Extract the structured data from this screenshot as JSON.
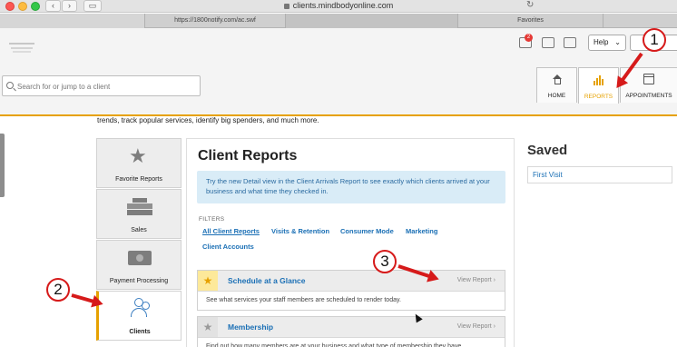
{
  "browser": {
    "url": "clients.mindbodyonline.com",
    "tabs": [
      "https://1800notify.com/ac.swf",
      "",
      "Favorites"
    ]
  },
  "header": {
    "notification_count": "2",
    "help_label": "Help",
    "search_placeholder": "Search for or jump to a client",
    "main_tabs": [
      {
        "label": "HOME",
        "icon": "home-icon"
      },
      {
        "label": "REPORTS",
        "icon": "bar-chart-icon"
      },
      {
        "label": "APPOINTMENTS",
        "icon": "calendar-icon"
      }
    ],
    "accent_color": "#e6a100"
  },
  "intro_text": "trends, track popular services, identify big spenders, and much more.",
  "sidebar": {
    "items": [
      {
        "label": "Favorite Reports",
        "icon": "star-icon"
      },
      {
        "label": "Sales",
        "icon": "cash-register-icon"
      },
      {
        "label": "Payment Processing",
        "icon": "credit-card-icon"
      },
      {
        "label": "Clients",
        "icon": "people-icon"
      }
    ]
  },
  "main": {
    "title": "Client Reports",
    "info": "Try the new Detail view in the Client Arrivals Report to see exactly which clients arrived at your business and what time they checked in.",
    "filters_label": "FILTERS",
    "filters": [
      "All Client Reports",
      "Visits & Retention",
      "Consumer Mode",
      "Marketing",
      "Client Accounts"
    ],
    "reports": [
      {
        "name": "Schedule at a Glance",
        "view": "View Report",
        "desc": "See what services your staff members are scheduled to render today.",
        "favorite": true
      },
      {
        "name": "Membership",
        "view": "View Report",
        "desc": "Find out how many members are at your business and what type of membership they have",
        "favorite": false
      }
    ]
  },
  "saved": {
    "title": "Saved",
    "items": [
      "First Visit"
    ]
  },
  "annotations": [
    "1",
    "2",
    "3"
  ]
}
